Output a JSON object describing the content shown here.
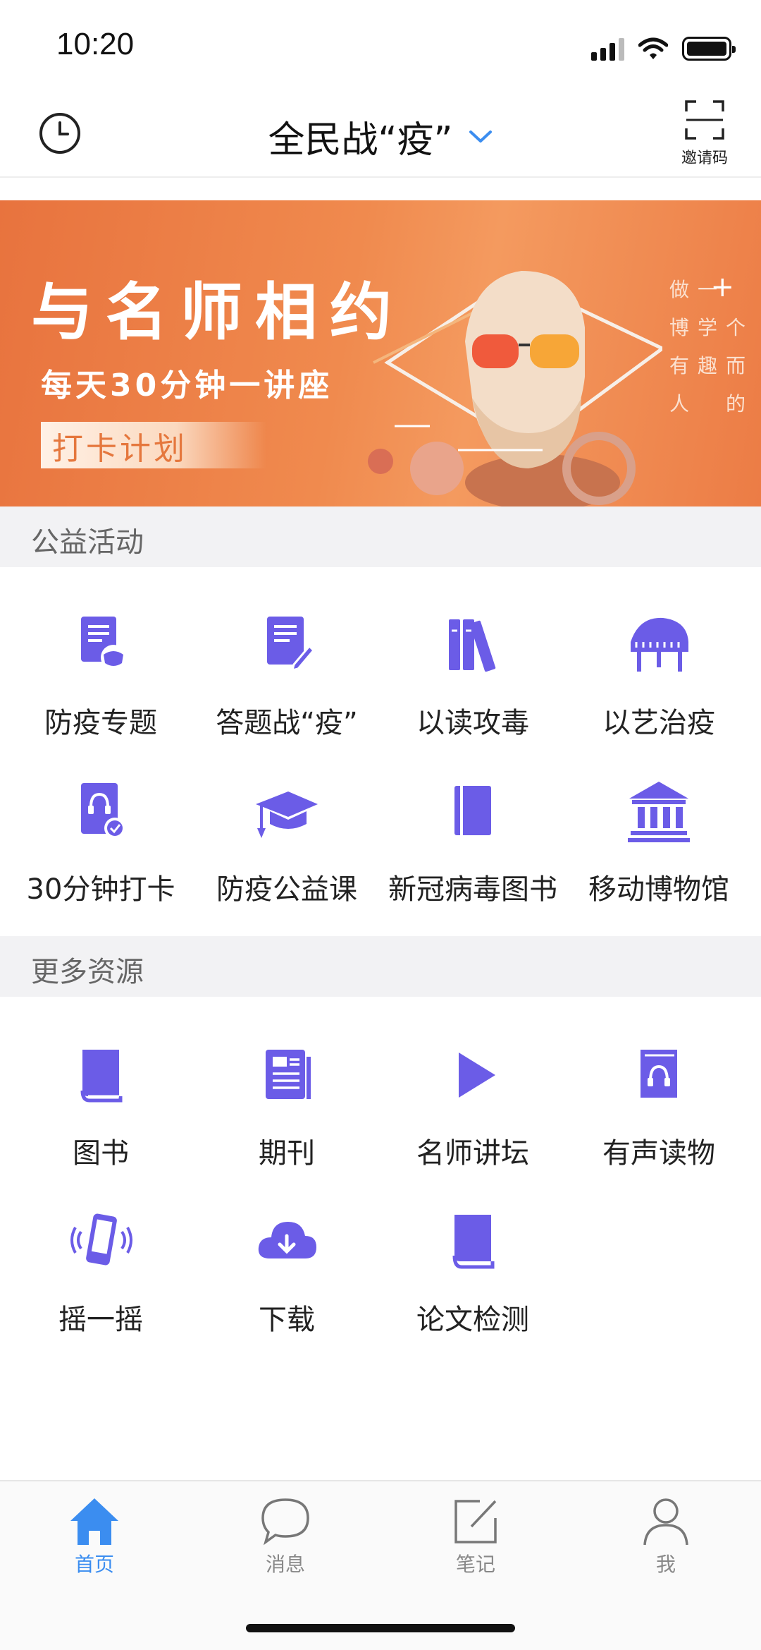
{
  "status_bar": {
    "time": "10:20"
  },
  "header": {
    "title": "全民战“疫”",
    "invite_label": "邀请码"
  },
  "banner": {
    "title": "与名师相约",
    "subtitle": "每天30分钟一讲座",
    "tag": "打卡计划",
    "vertical_lines": [
      "做博有人",
      "一学趣",
      "个而的"
    ],
    "plus": "+"
  },
  "sections": {
    "public_welfare": {
      "title": "公益活动",
      "items": [
        {
          "label": "防疫专题",
          "icon": "mask-document-icon"
        },
        {
          "label": "答题战“疫”",
          "icon": "quiz-document-icon"
        },
        {
          "label": "以读攻毒",
          "icon": "books-icon"
        },
        {
          "label": "以艺治疫",
          "icon": "piano-icon"
        },
        {
          "label": "30分钟打卡",
          "icon": "audio-checkin-icon"
        },
        {
          "label": "防疫公益课",
          "icon": "graduation-cap-icon"
        },
        {
          "label": "新冠病毒图书",
          "icon": "book-icon"
        },
        {
          "label": "移动博物馆",
          "icon": "museum-icon"
        }
      ]
    },
    "more_resources": {
      "title": "更多资源",
      "items": [
        {
          "label": "图书",
          "icon": "book-icon"
        },
        {
          "label": "期刊",
          "icon": "journal-icon"
        },
        {
          "label": "名师讲坛",
          "icon": "play-icon"
        },
        {
          "label": "有声读物",
          "icon": "audiobook-icon"
        },
        {
          "label": "摇一摇",
          "icon": "shake-phone-icon"
        },
        {
          "label": "下载",
          "icon": "cloud-download-icon"
        },
        {
          "label": "论文检测",
          "icon": "paper-check-icon"
        }
      ]
    }
  },
  "tabbar": {
    "tabs": [
      {
        "label": "首页",
        "icon": "home-icon",
        "active": true
      },
      {
        "label": "消息",
        "icon": "message-icon",
        "active": false
      },
      {
        "label": "笔记",
        "icon": "note-icon",
        "active": false
      },
      {
        "label": "我",
        "icon": "profile-icon",
        "active": false
      }
    ]
  },
  "colors": {
    "accent": "#6b5ce7",
    "tab_active": "#3b8df0",
    "banner_orange": "#ec7c45",
    "chevron": "#3b8df0"
  }
}
